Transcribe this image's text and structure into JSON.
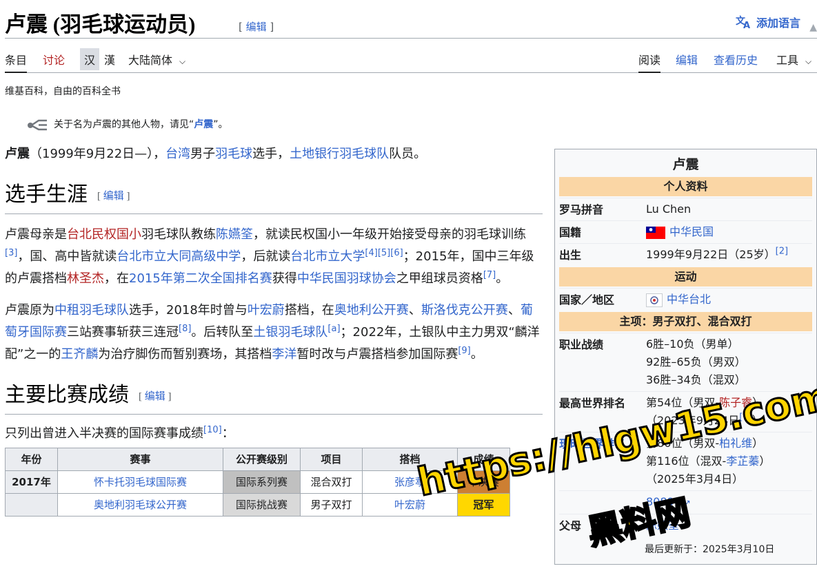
{
  "header": {
    "title": "卢震 (羽毛球运动员)",
    "edit_label": "编辑",
    "lang_button": "添加语言"
  },
  "tabs": {
    "article": "条目",
    "talk": "讨论",
    "hans": "汉",
    "hant": "漢",
    "variant": "大陆简体",
    "read": "阅读",
    "edit": "编辑",
    "history": "查看历史",
    "tools": "工具"
  },
  "tagline": "维基百科，自由的百科全书",
  "hatnote": {
    "prefix": "关于名为卢震的其他人物，请见“",
    "link": "卢震",
    "suffix": "”。"
  },
  "intro": {
    "name": "卢震",
    "born": "（1999年9月22日—），",
    "link1": "台湾",
    "t1": "男子",
    "link2": "羽毛球",
    "t2": "选手，",
    "link3": "土地银行羽毛球队",
    "t3": "队员。"
  },
  "career": {
    "heading": "选手生涯",
    "p1": {
      "a": "卢震母亲是",
      "l1": "台北民权国小",
      "b": "羽毛球队教练",
      "l2": "陈嬿筌",
      "c": "，就读民权国小一年级开始接受母亲的羽毛球训练",
      "r1": "[3]",
      "d": "，国、高中皆就读",
      "l3": "台北市立大同高级中学",
      "e": "，后就读",
      "l4": "台北市立大学",
      "r2": "[4]",
      "r3": "[5]",
      "r4": "[6]",
      "f": "；2015年，国中三年级的卢震搭档",
      "l5": "林圣杰",
      "g": "，在",
      "l6": "2015年第二次全国排名赛",
      "h": "获得",
      "l7": "中华民国羽球协会",
      "i": "之甲组球员资格",
      "r5": "[7]",
      "j": "。"
    },
    "p2": {
      "a": "卢震原为",
      "l1": "中租羽毛球队",
      "b": "选手，2018年时曾与",
      "l2": "叶宏蔚",
      "c": "搭档，在",
      "l3": "奥地利公开赛",
      "d": "、",
      "l4": "斯洛伐克公开赛",
      "e": "、",
      "l5": "葡萄牙国际赛",
      "f": "三站赛事斩获三连冠",
      "r1": "[8]",
      "g": "。后转队至",
      "l6": "土银羽毛球队",
      "r2": "[a]",
      "h": "；2022年，土银队中主力男双“麟洋配”之一的",
      "l7": "王齐麟",
      "i": "为治疗脚伤而暂别赛场，其搭档",
      "l8": "李洋",
      "j": "暂时改与卢震搭档参加国际赛",
      "r3": "[9]",
      "k": "。"
    }
  },
  "results": {
    "heading": "主要比赛成绩",
    "intro": "只列出曾进入半决赛的国际赛事成绩",
    "ref": "[10]",
    "intro_end": "：",
    "columns": [
      "年份",
      "赛事",
      "公开赛级别",
      "项目",
      "搭档",
      "成绩"
    ],
    "rows": [
      {
        "year": "2017年",
        "event": "怀卡托羽毛球国际赛",
        "level": "国际系列赛",
        "discipline": "混合双打",
        "partner": "张彦葶",
        "result": "半决赛"
      },
      {
        "year": "",
        "event": "奥地利羽毛球公开赛",
        "level": "国际挑战赛",
        "discipline": "男子双打",
        "partner": "叶宏蔚",
        "result": "冠军"
      }
    ]
  },
  "infobox": {
    "title": "卢震",
    "h_personal": "个人资料",
    "romanization_label": "罗马拼音",
    "romanization": "Lu Chen",
    "nationality_label": "国籍",
    "nationality": "中华民国",
    "born_label": "出生",
    "born": "1999年9月22日（25岁）",
    "born_ref": "[2]",
    "h_sport": "运动",
    "country_label": "国家／地区",
    "country": "中华台北",
    "h_main": "主项：男子双打、混合双打",
    "record_label": "职业战绩",
    "record": [
      "6胜–10负（男单）",
      "92胜–65负（男双）",
      "36胜–34负（混双）"
    ],
    "highest_label": "最高世界排名",
    "highest_a": "第54位（男双-",
    "highest_partner": "陈子睿",
    "highest_b": "）",
    "highest_date": "（2023年9月24日",
    "highest_ref": "[1]",
    "highest_date_end": "）",
    "current_label": "现时世界排名",
    "current_1a": "第86位（男双-",
    "current_1p": "柏礼维",
    "current_1b": "）",
    "current_2a": "第116位（混双-",
    "current_2p": "李芷蓁",
    "current_2b": "）",
    "current_date": "（2025年3月4日）",
    "bwf_id": "80896",
    "parents_label": "父母",
    "parents": "陈嬿筌",
    "updated": "最后更新于：2025年3月10日"
  },
  "watermark": {
    "url": "https://hlgw15.com",
    "brand": "黑料网"
  }
}
